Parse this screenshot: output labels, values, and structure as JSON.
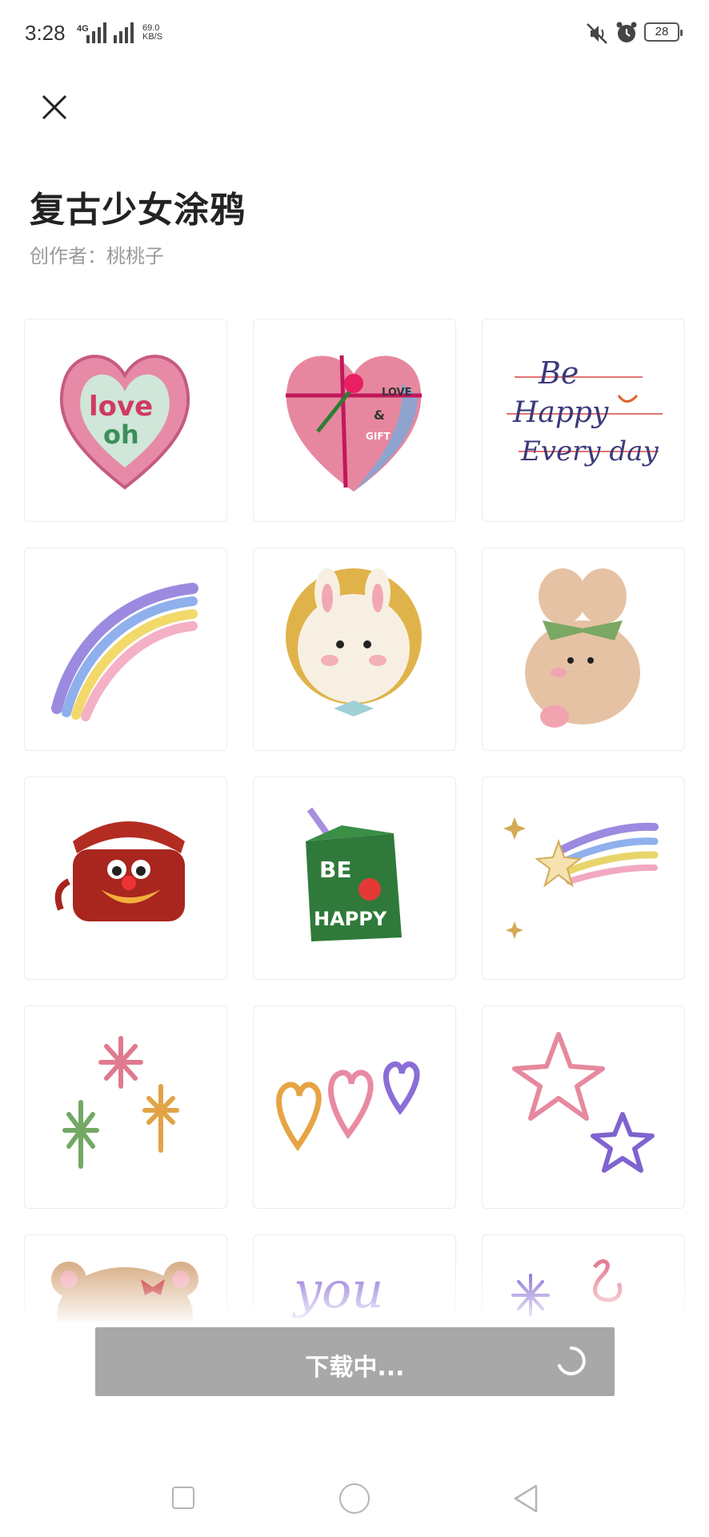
{
  "status_bar": {
    "time": "3:28",
    "network": "4G",
    "speed_value": "69.0",
    "speed_unit": "KB/S",
    "battery": "28"
  },
  "header": {
    "title": "复古少女涂鸦",
    "author_label": "创作者：",
    "author_name": "桃桃子"
  },
  "stickers": [
    {
      "name": "love-oh-heart",
      "text1": "love",
      "text2": "oh"
    },
    {
      "name": "gift-heart",
      "text1": "LOVE",
      "text2": "&",
      "text3": "GIFT"
    },
    {
      "name": "be-happy-everyday",
      "text1": "Be",
      "text2": "Happy",
      "text3": "Every day"
    },
    {
      "name": "rainbow"
    },
    {
      "name": "bunny-in-circle"
    },
    {
      "name": "bear-with-bow"
    },
    {
      "name": "red-telephone"
    },
    {
      "name": "be-happy-juice-box",
      "text1": "BE",
      "text2": "HAPPY"
    },
    {
      "name": "shooting-star-rainbow"
    },
    {
      "name": "sparkles"
    },
    {
      "name": "three-hearts"
    },
    {
      "name": "two-stars"
    },
    {
      "name": "bear-with-ribbon"
    },
    {
      "name": "you-text",
      "text1": "you"
    },
    {
      "name": "sparkle-letter"
    }
  ],
  "download_button": {
    "label": "下载中..."
  },
  "colors": {
    "title": "#222222",
    "author": "#9a9a9a",
    "download_bg": "#a8a8a8",
    "tile_border": "#ececec"
  }
}
